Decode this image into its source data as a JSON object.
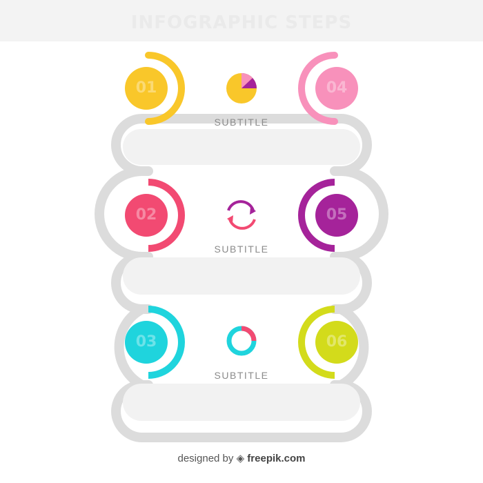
{
  "header": {
    "title": "INFOGRAPHIC STEPS"
  },
  "colors": {
    "step1": "#F9C72A",
    "step2": "#F24A72",
    "step3": "#1FD4DD",
    "step4": "#F891BB",
    "step5": "#A5239A",
    "step6": "#D3DB1B",
    "connector": "#dcdcdc",
    "pill_fill": "#f2f2f2"
  },
  "steps": {
    "s01": {
      "number": "01"
    },
    "s02": {
      "number": "02"
    },
    "s03": {
      "number": "03"
    },
    "s04": {
      "number": "04"
    },
    "s05": {
      "number": "05"
    },
    "s06": {
      "number": "06"
    }
  },
  "rows": [
    {
      "subtitle": "SUBTITLE",
      "icon": "pie-chart-icon"
    },
    {
      "subtitle": "SUBTITLE",
      "icon": "refresh-cycle-icon"
    },
    {
      "subtitle": "SUBTITLE",
      "icon": "donut-ring-icon"
    }
  ],
  "footer": {
    "prefix": "designed by",
    "brand": "freepik.com"
  }
}
